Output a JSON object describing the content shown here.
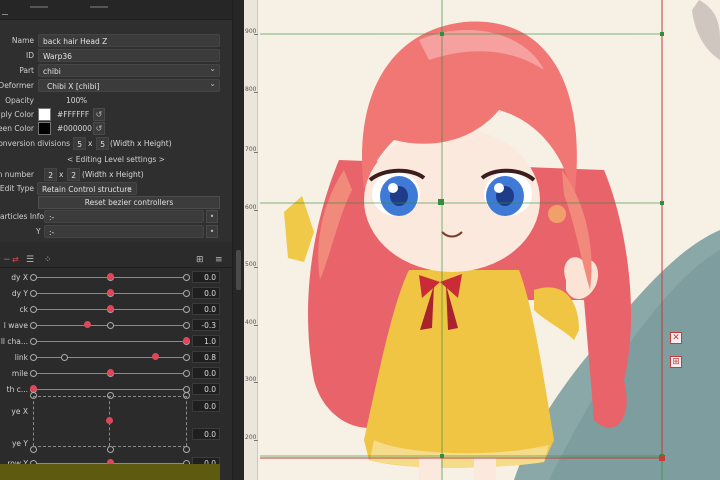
{
  "inspector": {
    "name": {
      "label": "Name",
      "value": "back hair Head Z"
    },
    "id": {
      "label": "ID",
      "value": "Warp36"
    },
    "part": {
      "label": "Part",
      "value": "chibi"
    },
    "deformer": {
      "label": "Deformer",
      "value": "Chibi X [chibi]"
    },
    "opacity": {
      "label": "Opacity",
      "value": "100",
      "unit": "%"
    },
    "multiply_color": {
      "label": "tiply Color",
      "value": "#FFFFFF",
      "color": "#ffffff"
    },
    "screen_color": {
      "label": "reen Color",
      "value": "#000000",
      "color": "#000000"
    },
    "conversion_divisions": {
      "label": "onversion divisions",
      "x": "5",
      "sep": "x",
      "y": "5",
      "suffix": "(Width x Height)"
    },
    "editing_level_header": "< Editing Level settings >",
    "division_number": {
      "label": "on number",
      "x": "2",
      "sep": "x",
      "y": "2",
      "suffix": "(Width x Height)"
    },
    "edit_type": {
      "label": "r Edit Type",
      "value": "Retain Control structure"
    },
    "reset_button": "Reset bezier controllers",
    "particles_x": {
      "label": "articles Info X",
      "value": ":-"
    },
    "particles_y": {
      "label": "Y",
      "value": ":-"
    }
  },
  "params": [
    {
      "name": "dy X",
      "value": "0.0",
      "knob": 0.5,
      "marks": [
        0,
        0.5,
        1
      ]
    },
    {
      "name": "dy Y",
      "value": "0.0",
      "knob": 0.5,
      "marks": [
        0,
        0.5,
        1
      ]
    },
    {
      "name": "ck",
      "value": "0.0",
      "knob": 0.5,
      "marks": [
        0,
        0.5,
        1
      ]
    },
    {
      "name": "l wave",
      "value": "-0.3",
      "knob": 0.35,
      "marks": [
        0,
        0.5,
        1
      ]
    },
    {
      "name": "ll cha...",
      "value": "1.0",
      "knob": 1.0,
      "marks": [
        0,
        1
      ]
    },
    {
      "name": "link",
      "value": "0.8",
      "knob": 0.8,
      "marks": [
        0,
        0.2,
        1
      ]
    },
    {
      "name": "mile",
      "value": "0.0",
      "knob": 0.5,
      "marks": [
        0,
        0.5,
        1
      ]
    },
    {
      "name": "th c...",
      "value": "0.0",
      "knob": 0.0,
      "marks": [
        0,
        1
      ]
    },
    {
      "name": "ye X",
      "value": "0.0",
      "knob": 0.5,
      "marks": [
        0,
        0.5,
        1
      ]
    },
    {
      "name": "ye Y",
      "value": "0.0",
      "knob": 0.5,
      "marks": [
        0,
        0.5,
        1
      ]
    },
    {
      "name": "row Y",
      "value": "0.0",
      "knob": 0.5,
      "marks": [
        0,
        0.5,
        1
      ]
    }
  ],
  "ruler": [
    "900",
    "800",
    "700",
    "600",
    "500",
    "400",
    "300",
    "200"
  ],
  "colors": {
    "accent": "#e0465a",
    "mesh": "#2f8f3a",
    "warp": "#c53c3c",
    "hair": "#ee7b78",
    "uniform": "#f0c544"
  }
}
